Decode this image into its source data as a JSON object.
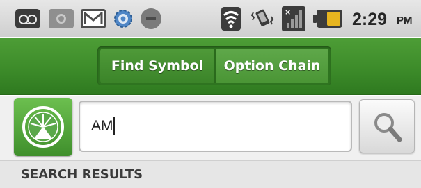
{
  "status_bar": {
    "icons": [
      "voicemail-icon",
      "photo-icon",
      "gmail-icon",
      "settings-icon",
      "block-icon",
      "wifi-icon",
      "vibrate-icon",
      "signal-icon",
      "battery-icon"
    ],
    "time": "2:29",
    "ampm": "PM",
    "battery_color": "#e7b51f"
  },
  "toolbar": {
    "background": "#3d8c2a",
    "tabs": [
      {
        "label": "Find Symbol"
      },
      {
        "label": "Option Chain"
      }
    ]
  },
  "search": {
    "value": "AM",
    "button_icon": "search-icon",
    "logo_icon": "app-logo-icon"
  },
  "results": {
    "header": "SEARCH RESULTS"
  }
}
